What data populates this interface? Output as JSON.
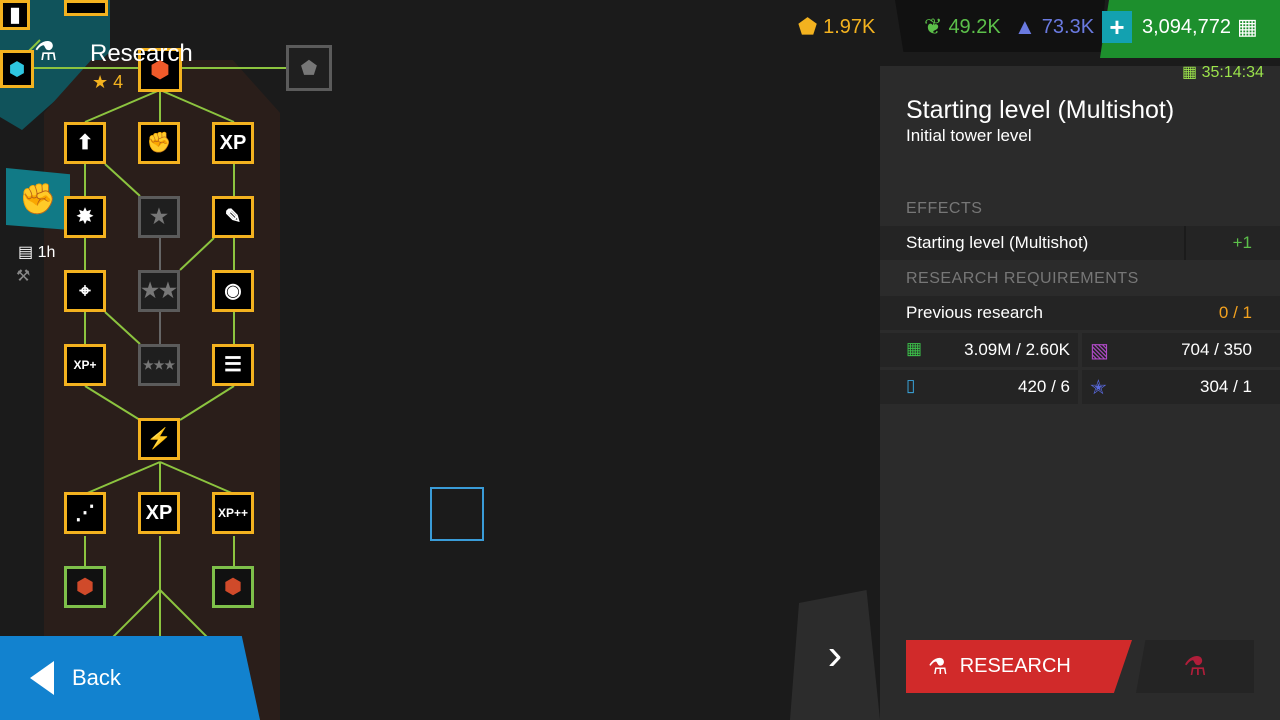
{
  "header": {
    "title": "Research",
    "stars": "4"
  },
  "side": {
    "timer": "1h"
  },
  "currencies": [
    {
      "name": "orange-gem",
      "value": "1.97K",
      "color": "#f3b21f"
    },
    {
      "name": "green-leaf",
      "value": "49.2K",
      "color": "#5cc04a"
    },
    {
      "name": "blue-mountain",
      "value": "73.3K",
      "color": "#6a7ae0"
    },
    {
      "name": "cash",
      "value": "3,094,772",
      "color": "#ffffff"
    }
  ],
  "countdown": "35:14:34",
  "panel": {
    "title": "Starting level (Multishot)",
    "subtitle": "Initial tower level",
    "effects_header": "EFFECTS",
    "effect_label": "Starting level (Multishot)",
    "effect_value": "+1",
    "req_header": "RESEARCH REQUIREMENTS",
    "prev_label": "Previous research",
    "prev_value": "0 / 1",
    "costs": [
      {
        "icon": "cash-icon",
        "value": "3.09M / 2.60K"
      },
      {
        "icon": "purple-stripes-icon",
        "value": "704 / 350"
      },
      {
        "icon": "xp-scroll-icon",
        "value": "420 / 6"
      },
      {
        "icon": "blue-star-card-icon",
        "value": "304 / 1"
      }
    ],
    "research_label": "RESEARCH"
  },
  "nav": {
    "back_label": "Back"
  },
  "tree_nodes": [
    {
      "name": "node-max-up",
      "glyph": "⬆",
      "state": "active"
    },
    {
      "name": "node-fist",
      "glyph": "✊",
      "state": "active"
    },
    {
      "name": "node-max-xp",
      "glyph": "XP",
      "state": "active"
    },
    {
      "name": "node-multishot",
      "glyph": "✸",
      "state": "active"
    },
    {
      "name": "node-star-1",
      "glyph": "★",
      "state": "locked"
    },
    {
      "name": "node-pen",
      "glyph": "✎",
      "state": "active"
    },
    {
      "name": "node-crosshair",
      "glyph": "⌖",
      "state": "active"
    },
    {
      "name": "node-star-2",
      "glyph": "★★",
      "state": "locked"
    },
    {
      "name": "node-gem",
      "glyph": "◉",
      "state": "active"
    },
    {
      "name": "node-xp-plus",
      "glyph": "XP+",
      "state": "active"
    },
    {
      "name": "node-star-3",
      "glyph": "★★★",
      "state": "locked"
    },
    {
      "name": "node-list",
      "glyph": "☰",
      "state": "active"
    },
    {
      "name": "node-lightning",
      "glyph": "⚡",
      "state": "active"
    },
    {
      "name": "node-shots",
      "glyph": "⋰",
      "state": "active"
    },
    {
      "name": "node-xp-card",
      "glyph": "XP",
      "state": "active"
    },
    {
      "name": "node-xp-plus-plus",
      "glyph": "XP++",
      "state": "active"
    },
    {
      "name": "node-red-cube-fist",
      "glyph": "⬢",
      "state": "green"
    },
    {
      "name": "node-red-cube-shot",
      "glyph": "⬢",
      "state": "green"
    }
  ]
}
